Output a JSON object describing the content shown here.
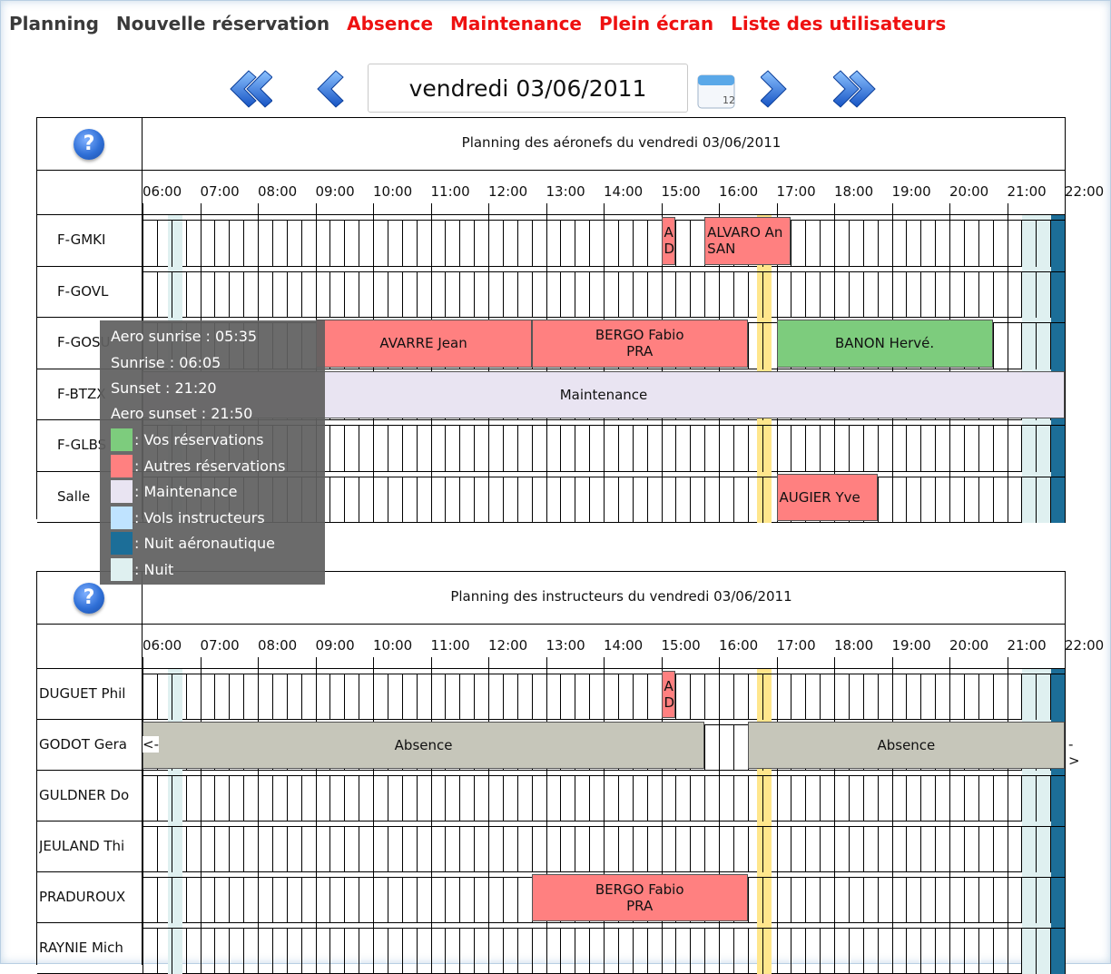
{
  "menu": {
    "planning": "Planning",
    "nouvelle_reservation": "Nouvelle réservation",
    "absence": "Absence",
    "maintenance": "Maintenance",
    "plein_ecran": "Plein écran",
    "liste_utilisateurs": "Liste des utilisateurs"
  },
  "date_nav": {
    "date": "vendredi 03/06/2011",
    "calendar_icon_day": "12",
    "icons": [
      "double-chevron-left-icon",
      "chevron-left-icon",
      "calendar-icon",
      "chevron-right-icon",
      "double-chevron-right-icon"
    ]
  },
  "colors": {
    "vos_reservations": "#7dcc7d",
    "autres_reservations": "#ff8080",
    "maintenance": "#e9e4f2",
    "vols_instructeurs": "#bfe3ff",
    "nuit_aeronautique": "#1c6e98",
    "nuit": "#dff0f0",
    "absence": "#c6c6ba",
    "sun_marker": "#ffe68c",
    "menu_active": "#3a3a3a",
    "menu_link": "#ee1111",
    "nav_arrow": "#1e6fd8"
  },
  "time_axis": {
    "ticks": [
      "06:00",
      "07:00",
      "08:00",
      "09:00",
      "10:00",
      "11:00",
      "12:00",
      "13:00",
      "14:00",
      "15:00",
      "16:00",
      "17:00",
      "18:00",
      "19:00",
      "20:00",
      "21:00",
      "22:00"
    ]
  },
  "aircraft_planning": {
    "title": "Planning des aéronefs du vendredi 03/06/2011",
    "rows": [
      {
        "label": "F-GMKI",
        "bars": [
          {
            "type": "autres",
            "line1": "ALVA",
            "line2": "DUG",
            "start": "15:00",
            "end": "15:15"
          },
          {
            "type": "autres",
            "line1": "ALVARO An",
            "line2": "SAN",
            "start": "15:45",
            "end": "17:15"
          }
        ]
      },
      {
        "label": "F-GOVL",
        "bars": []
      },
      {
        "label": "F-GOSU",
        "bars": [
          {
            "type": "autres",
            "line1": "AVARRE Jean",
            "line2": "",
            "start": "09:00",
            "end": "12:45"
          },
          {
            "type": "autres",
            "line1": "BERGO Fabio",
            "line2": "PRA",
            "start": "12:45",
            "end": "16:30"
          },
          {
            "type": "vos",
            "line1": "BANON Hervé.",
            "line2": "",
            "start": "17:00",
            "end": "20:45"
          }
        ]
      },
      {
        "label": "F-BTZX",
        "bars": [
          {
            "type": "maintenance",
            "line1": "Maintenance",
            "line2": "",
            "start": "06:00",
            "end": "22:00"
          }
        ]
      },
      {
        "label": "F-GLBS",
        "bars": []
      },
      {
        "label": "Salle",
        "bars": [
          {
            "type": "autres",
            "line1": "AUGIER Yve",
            "line2": "",
            "start": "17:00",
            "end": "18:45"
          }
        ]
      }
    ]
  },
  "instructor_planning": {
    "title": "Planning des instructeurs du vendredi 03/06/2011",
    "rows": [
      {
        "label": "DUGUET Phil",
        "bars": [
          {
            "type": "autres",
            "line1": "ALVA",
            "line2": "DUG",
            "start": "15:00",
            "end": "15:15"
          }
        ]
      },
      {
        "label": "GODOT Gera",
        "bars": [
          {
            "type": "absence",
            "line1": "Absence",
            "line2": "",
            "start": "06:00",
            "end": "15:45"
          },
          {
            "type": "absence",
            "line1": "Absence",
            "line2": "",
            "start": "16:30",
            "end": "22:00"
          }
        ],
        "left_arrow": "<-",
        "right_arrow": "->"
      },
      {
        "label": "GULDNER Do",
        "bars": []
      },
      {
        "label": "JEULAND Thi",
        "bars": []
      },
      {
        "label": "PRADUROUX",
        "bars": [
          {
            "type": "autres",
            "line1": "BERGO Fabio",
            "line2": "PRA",
            "start": "12:45",
            "end": "16:30"
          }
        ]
      },
      {
        "label": "RAYNIE Mich",
        "bars": []
      }
    ]
  },
  "legend": {
    "aero_sunrise": "Aero sunrise : 05:35",
    "sunrise": "Sunrise : 06:05",
    "sunset": "Sunset : 21:20",
    "aero_sunset": "Aero sunset : 21:50",
    "items": [
      {
        "key": "vos_reservations",
        "label": ": Vos réservations"
      },
      {
        "key": "autres_reservations",
        "label": ": Autres réservations"
      },
      {
        "key": "maintenance",
        "label": ": Maintenance"
      },
      {
        "key": "vols_instructeurs",
        "label": ": Vols instructeurs"
      },
      {
        "key": "nuit_aeronautique",
        "label": ": Nuit aéronautique"
      },
      {
        "key": "nuit",
        "label": ": Nuit"
      }
    ]
  },
  "help_icon": "?"
}
